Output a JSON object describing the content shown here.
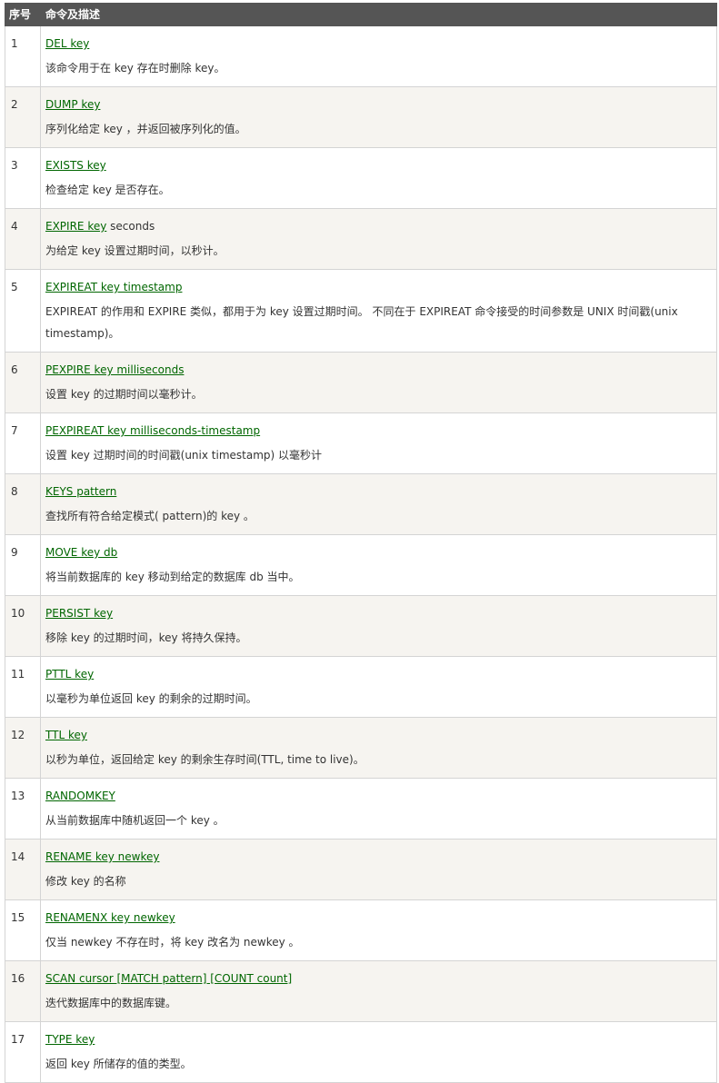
{
  "table": {
    "headers": {
      "num": "序号",
      "desc": "命令及描述"
    },
    "rows": [
      {
        "num": "1",
        "cmd": "DEL key",
        "suffix": "",
        "desc": "该命令用于在 key 存在时删除 key。"
      },
      {
        "num": "2",
        "cmd": "DUMP key",
        "suffix": "",
        "desc": "序列化给定 key ，并返回被序列化的值。"
      },
      {
        "num": "3",
        "cmd": "EXISTS key",
        "suffix": "",
        "desc": "检查给定 key 是否存在。"
      },
      {
        "num": "4",
        "cmd": "EXPIRE key",
        "suffix": " seconds",
        "desc": "为给定 key 设置过期时间，以秒计。"
      },
      {
        "num": "5",
        "cmd": "EXPIREAT key timestamp",
        "suffix": "",
        "desc": "EXPIREAT 的作用和 EXPIRE 类似，都用于为 key 设置过期时间。 不同在于 EXPIREAT 命令接受的时间参数是 UNIX 时间戳(unix timestamp)。"
      },
      {
        "num": "6",
        "cmd": "PEXPIRE key milliseconds",
        "suffix": "",
        "desc": "设置 key 的过期时间以毫秒计。"
      },
      {
        "num": "7",
        "cmd": "PEXPIREAT key milliseconds-timestamp",
        "suffix": "",
        "desc": "设置 key 过期时间的时间戳(unix timestamp) 以毫秒计"
      },
      {
        "num": "8",
        "cmd": "KEYS pattern",
        "suffix": "",
        "desc": "查找所有符合给定模式( pattern)的 key 。"
      },
      {
        "num": "9",
        "cmd": "MOVE key db",
        "suffix": "",
        "desc": "将当前数据库的 key 移动到给定的数据库 db 当中。"
      },
      {
        "num": "10",
        "cmd": "PERSIST key",
        "suffix": "",
        "desc": "移除 key 的过期时间，key 将持久保持。"
      },
      {
        "num": "11",
        "cmd": "PTTL key",
        "suffix": "",
        "desc": "以毫秒为单位返回 key 的剩余的过期时间。"
      },
      {
        "num": "12",
        "cmd": "TTL key",
        "suffix": "",
        "desc": "以秒为单位，返回给定 key 的剩余生存时间(TTL, time to live)。"
      },
      {
        "num": "13",
        "cmd": "RANDOMKEY",
        "suffix": "",
        "desc": "从当前数据库中随机返回一个 key 。"
      },
      {
        "num": "14",
        "cmd": "RENAME key newkey",
        "suffix": "",
        "desc": "修改 key 的名称"
      },
      {
        "num": "15",
        "cmd": "RENAMENX key newkey",
        "suffix": "",
        "desc": "仅当 newkey 不存在时，将 key 改名为 newkey 。"
      },
      {
        "num": "16",
        "cmd": "SCAN cursor [MATCH pattern] [COUNT count]",
        "suffix": "",
        "desc": "迭代数据库中的数据库键。"
      },
      {
        "num": "17",
        "cmd": "TYPE key",
        "suffix": "",
        "desc": "返回 key 所储存的值的类型。"
      }
    ]
  }
}
